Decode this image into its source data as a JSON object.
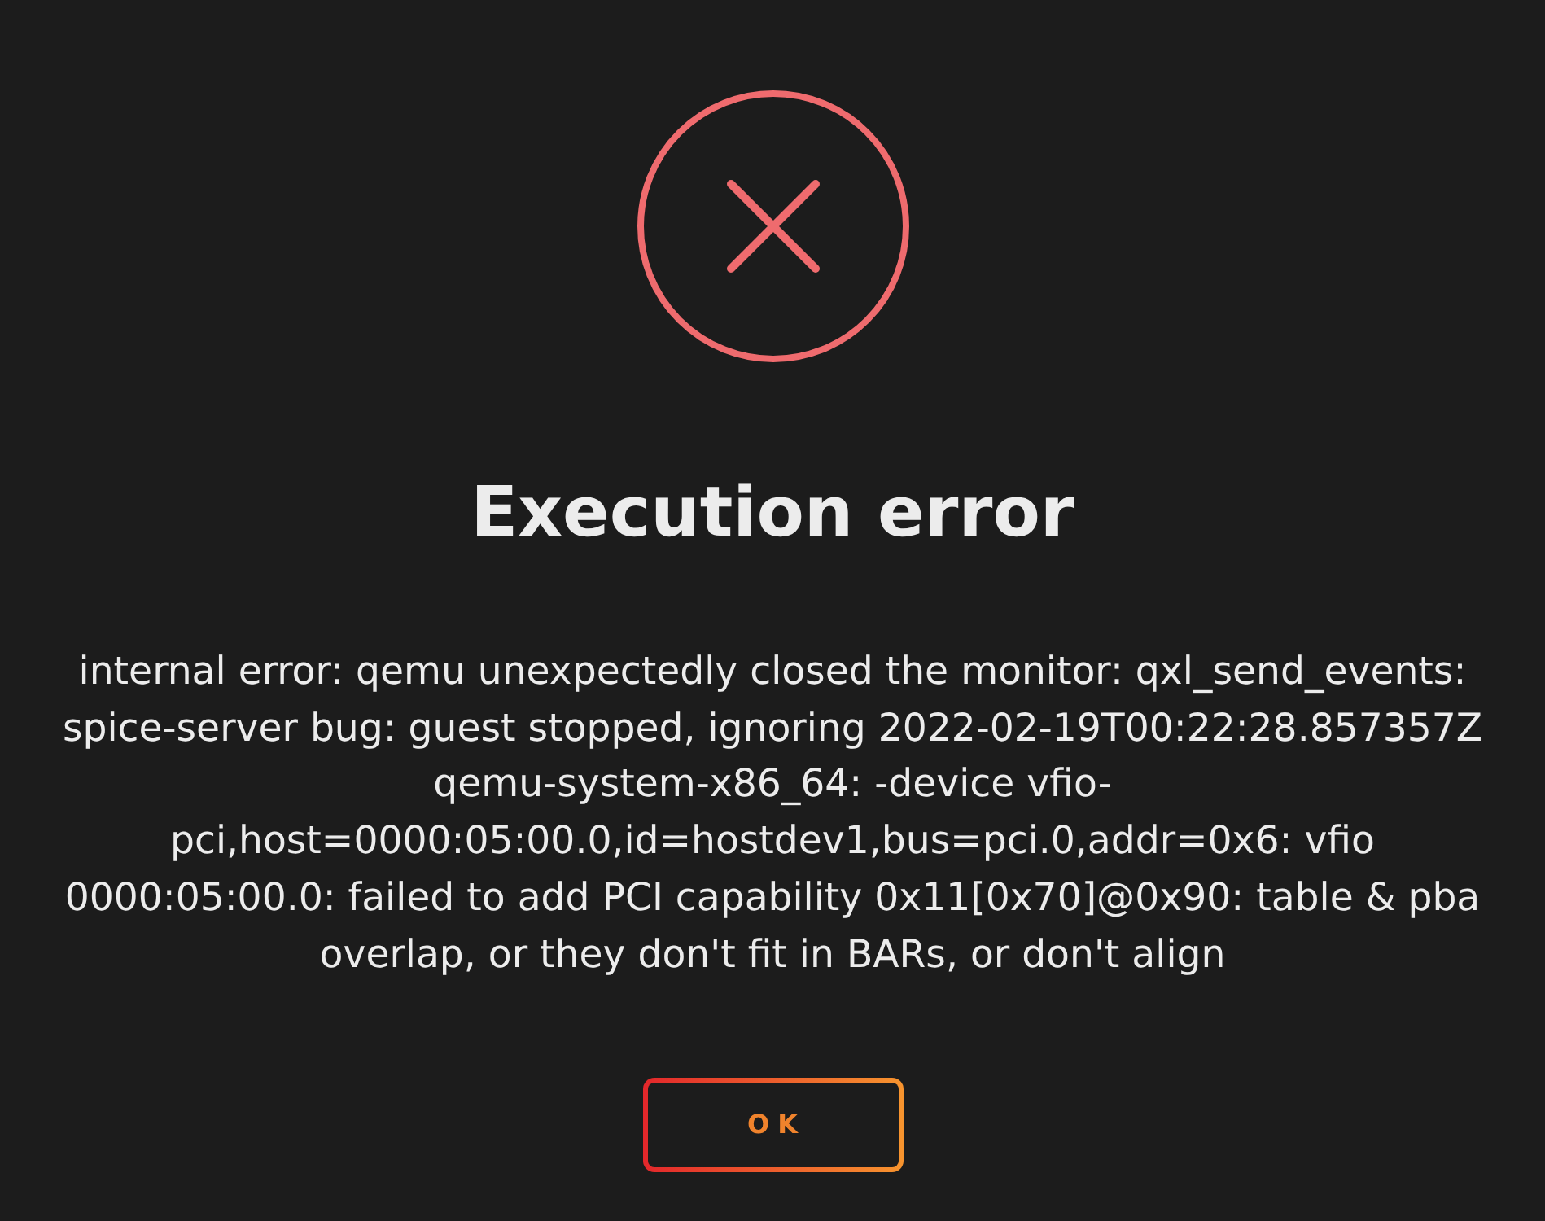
{
  "dialog": {
    "title": "Execution error",
    "message": "internal error: qemu unexpectedly closed the monitor: qxl_send_events: spice-server bug: guest stopped, ignoring 2022-02-19T00:22:28.857357Z qemu-system-x86_64: -device vfio-pci,host=0000:05:00.0,id=hostdev1,bus=pci.0,addr=0x6: vfio 0000:05:00.0: failed to add PCI capability 0x11[0x70]@0x90: table & pba overlap, or they don't fit in BARs, or don't align",
    "buttons": [
      "OK"
    ]
  }
}
